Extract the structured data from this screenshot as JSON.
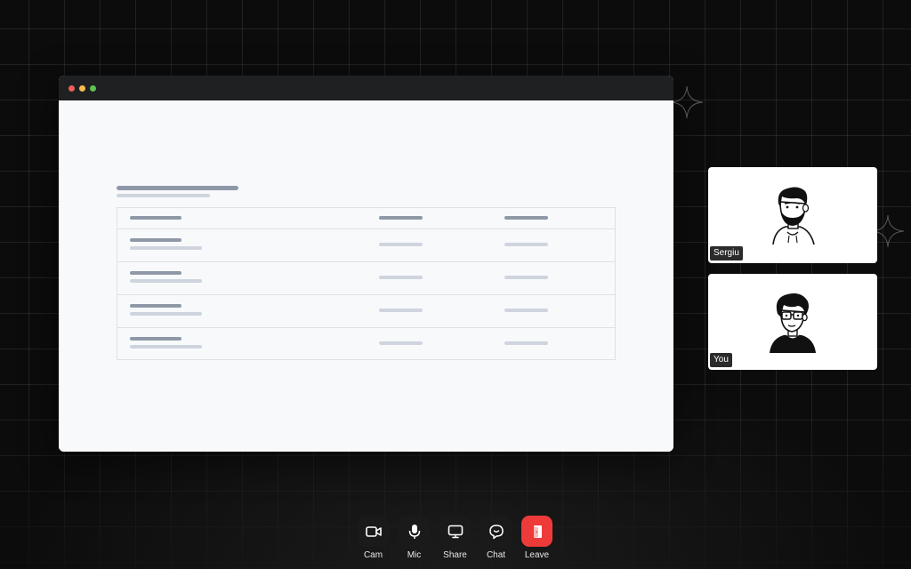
{
  "participants": [
    {
      "name": "Sergiu",
      "icon": "bearded-man-avatar-icon"
    },
    {
      "name": "You",
      "icon": "man-with-glasses-avatar-icon"
    }
  ],
  "controls": [
    {
      "label": "Cam",
      "icon": "camera-icon"
    },
    {
      "label": "Mic",
      "icon": "microphone-icon"
    },
    {
      "label": "Share",
      "icon": "monitor-share-icon"
    },
    {
      "label": "Chat",
      "icon": "chat-bubble-icon"
    },
    {
      "label": "Leave",
      "icon": "leave-door-icon"
    }
  ],
  "colors": {
    "background": "#0c0c0c",
    "leave_button": "#ef3a3a",
    "window_titlebar": "#1e2022",
    "traffic_red": "#ee5f57",
    "traffic_yellow": "#f5bd4f",
    "traffic_green": "#5fc453"
  }
}
